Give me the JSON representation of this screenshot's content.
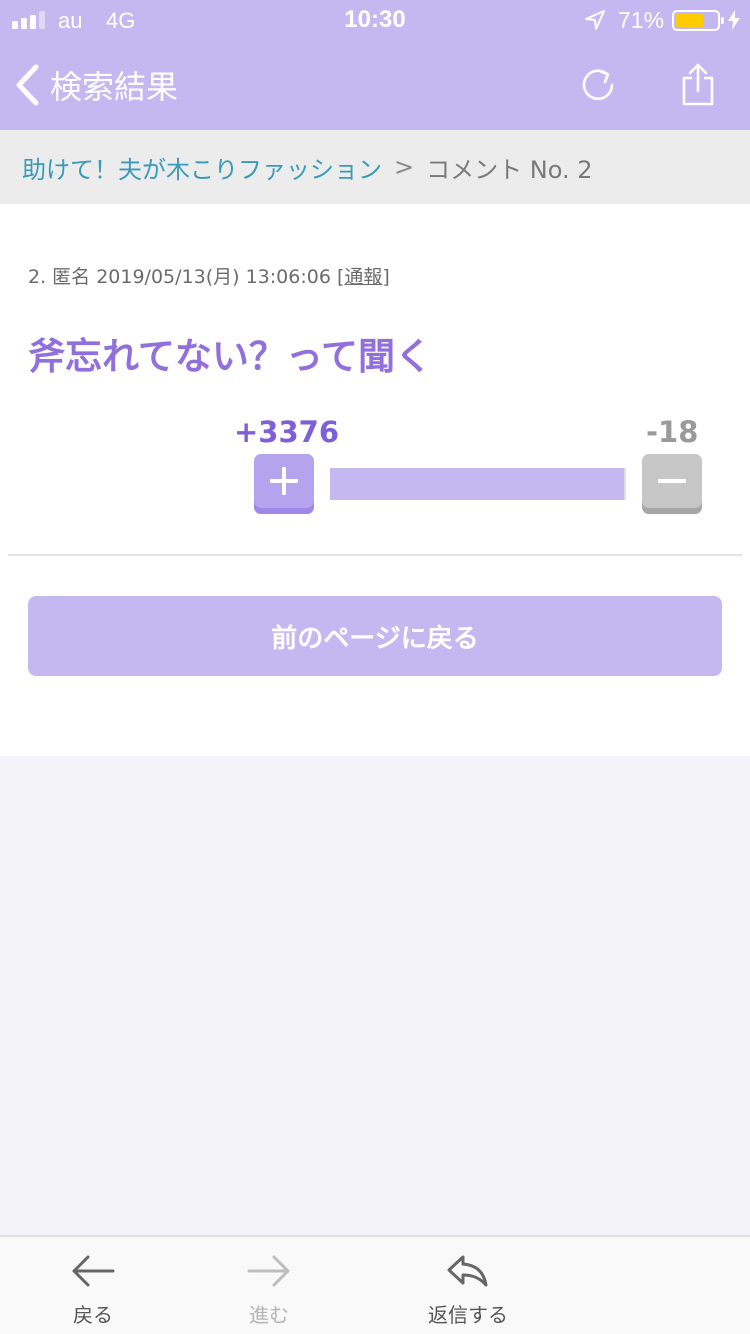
{
  "status_bar": {
    "carrier": "au",
    "network": "4G",
    "time": "10:30",
    "battery_percent": "71%",
    "battery_level": 0.71,
    "signal_bars_filled": 3,
    "signal_bars_total": 4
  },
  "nav": {
    "back_label": "検索結果",
    "icons": [
      "reload-icon",
      "share-icon"
    ]
  },
  "breadcrumb": {
    "parent": "助けて！夫が木こりファッション",
    "separator": ">",
    "current": "コメント No. 2"
  },
  "comment": {
    "meta": "2. 匿名 2019/05/13(月) 13:06:06 [",
    "report_label": "通報",
    "meta_end": "]",
    "body": "斧忘れてない？って聞く",
    "plus_count": "+3376",
    "minus_count": "-18",
    "positive_ratio": 0.9947
  },
  "prev_page_button": "前のページに戻る",
  "toolbar": {
    "back": "戻る",
    "forward": "進む",
    "reply": "返信する"
  },
  "colors": {
    "accent": "#c5b8f1",
    "accent_dark": "#9170de",
    "link": "#3a9bb8",
    "battery": "#ffcc00"
  }
}
